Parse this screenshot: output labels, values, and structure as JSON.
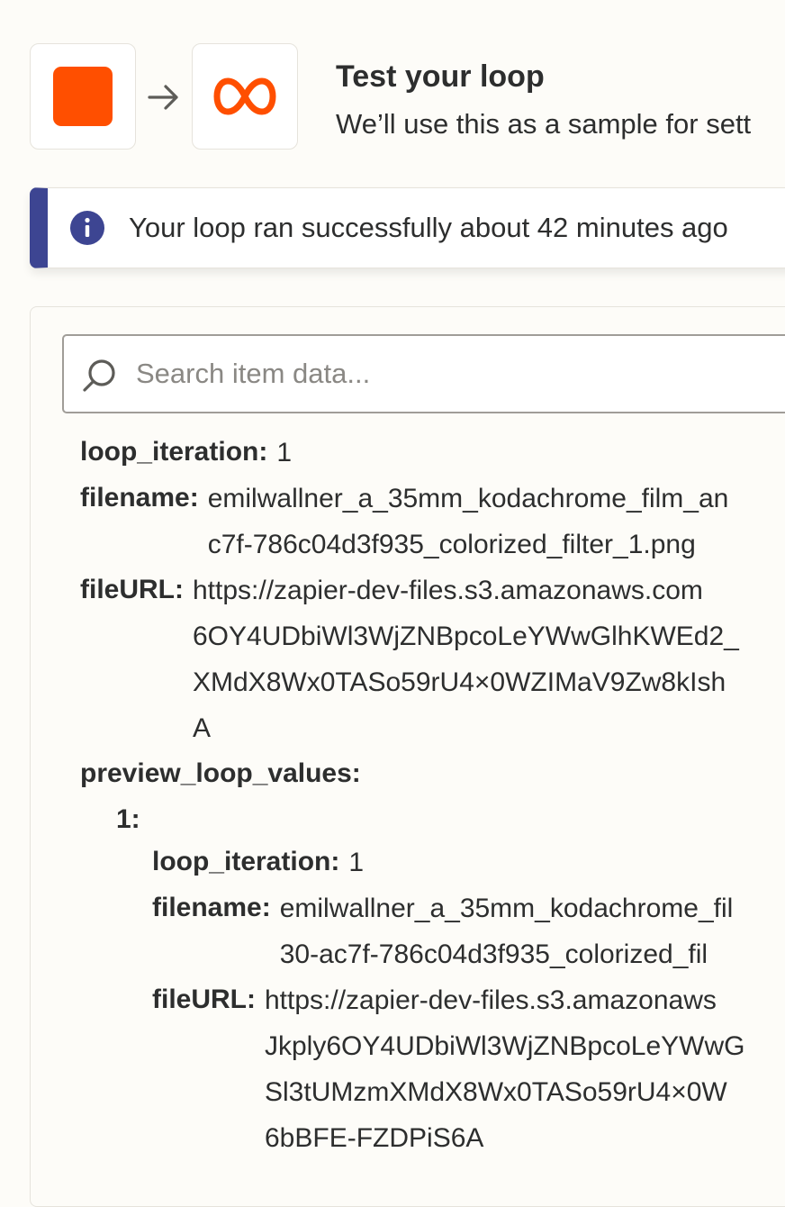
{
  "header": {
    "title": "Test your loop",
    "subtitle": "We’ll use this as a sample for sett"
  },
  "colors": {
    "brand_orange": "#ff4f00",
    "info_accent": "#3d4592"
  },
  "alert": {
    "text": "Your loop ran successfully about 42 minutes ago"
  },
  "search": {
    "placeholder": "Search item data..."
  },
  "item": {
    "loop_iteration": {
      "key": "loop_iteration:",
      "value": "1"
    },
    "filename": {
      "key": "filename:",
      "lines": [
        "emilwallner_a_35mm_kodachrome_film_an",
        "c7f-786c04d3f935_colorized_filter_1.png"
      ]
    },
    "fileURL": {
      "key": "fileURL:",
      "lines": [
        "https://zapier-dev-files.s3.amazonaws.com",
        "6OY4UDbiWl3WjZNBpcoLeYWwGlhKWEd2_",
        "XMdX8Wx0TASo59rU4×0WZIMaV9Zw8kIsh",
        "A"
      ]
    },
    "preview_loop_values": {
      "key": "preview_loop_values:",
      "index_key": "1:",
      "loop_iteration": {
        "key": "loop_iteration:",
        "value": "1"
      },
      "filename": {
        "key": "filename:",
        "lines": [
          "emilwallner_a_35mm_kodachrome_fil",
          "30-ac7f-786c04d3f935_colorized_fil"
        ]
      },
      "fileURL": {
        "key": "fileURL:",
        "lines": [
          "https://zapier-dev-files.s3.amazonaws",
          "Jkply6OY4UDbiWl3WjZNBpcoLeYWwG",
          "Sl3tUMzmXMdX8Wx0TASo59rU4×0W",
          "6bBFE-FZDPiS6A"
        ]
      }
    }
  }
}
